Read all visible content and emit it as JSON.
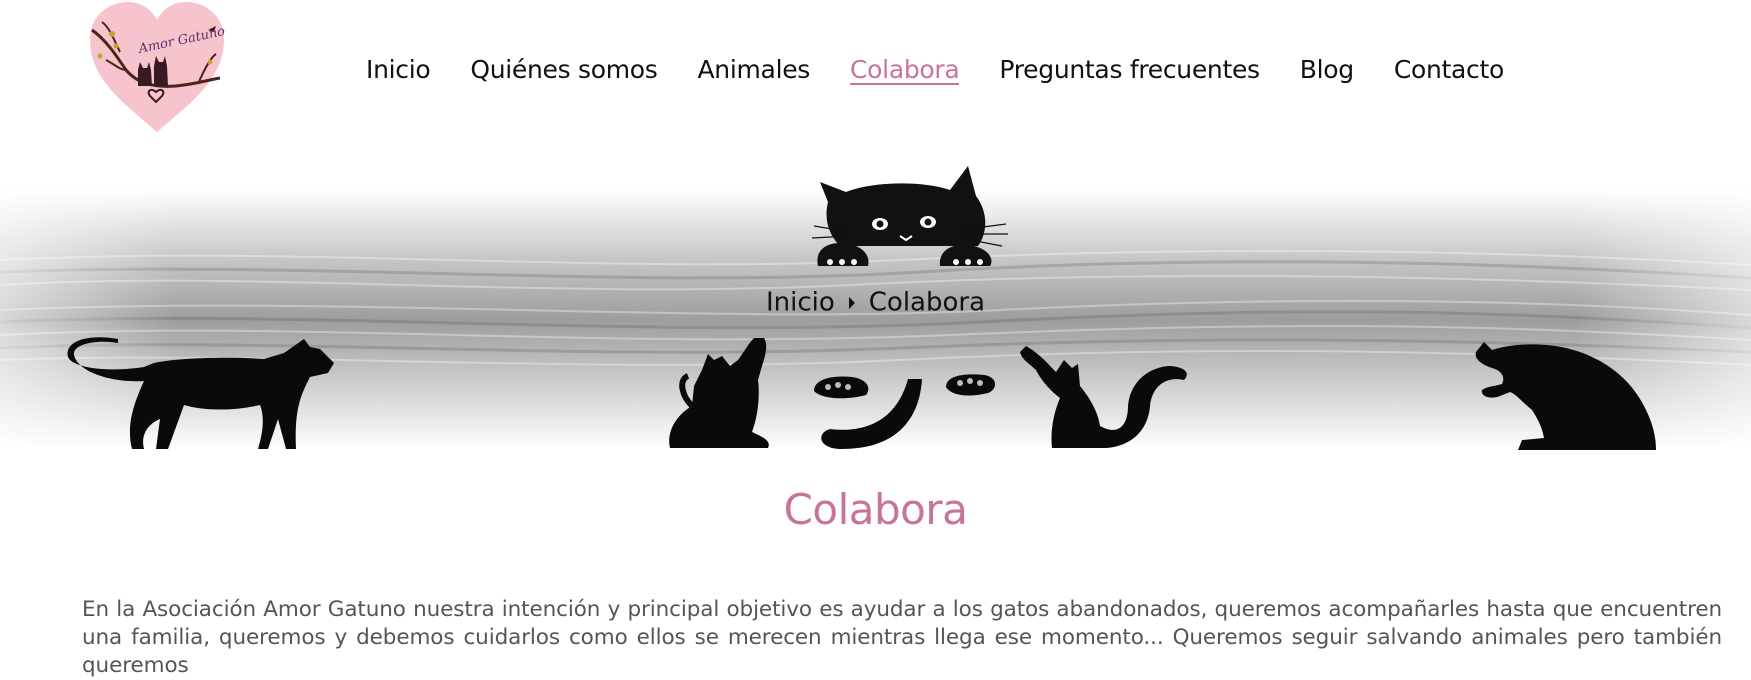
{
  "logo": {
    "text": "Amor Gatuno"
  },
  "nav": {
    "items": [
      {
        "label": "Inicio"
      },
      {
        "label": "Quiénes somos"
      },
      {
        "label": "Animales"
      },
      {
        "label": "Colabora",
        "active": true
      },
      {
        "label": "Preguntas frecuentes"
      },
      {
        "label": "Blog"
      },
      {
        "label": "Contacto"
      }
    ]
  },
  "breadcrumb": {
    "home": "Inicio",
    "current": "Colabora"
  },
  "page": {
    "title": "Colabora",
    "intro": "En la Asociación Amor Gatuno nuestra intención y principal objetivo es ayudar a los gatos abandonados, queremos acompañarles hasta que encuentren una familia, queremos y debemos cuidarlos como ellos se merecen mientras llega ese momento... Queremos seguir salvando animales pero también queremos"
  },
  "colors": {
    "accent": "#c8739b",
    "text": "#111111",
    "body_text": "#555555",
    "logo_heart": "#f7c4cd"
  }
}
